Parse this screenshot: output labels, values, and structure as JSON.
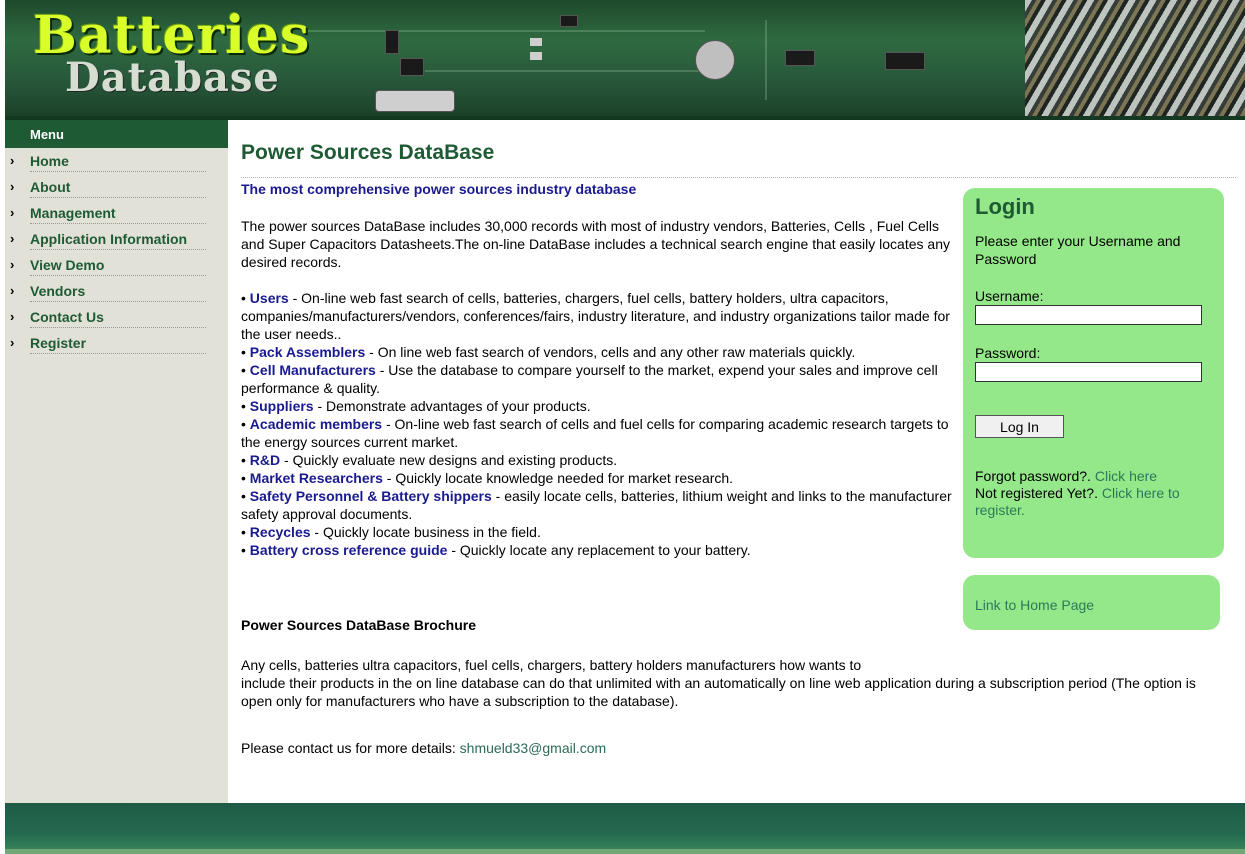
{
  "header": {
    "logo_title": "Batteries",
    "logo_subtitle": "Database"
  },
  "sidebar": {
    "title": "Menu",
    "items": [
      {
        "label": "Home"
      },
      {
        "label": "About"
      },
      {
        "label": "Management"
      },
      {
        "label": "Application Information"
      },
      {
        "label": "View Demo"
      },
      {
        "label": "Vendors"
      },
      {
        "label": "Contact Us"
      },
      {
        "label": "Register"
      }
    ]
  },
  "main": {
    "title": "Power Sources DataBase",
    "tagline": "The most comprehensive power sources industry database",
    "intro": "The  power sources DataBase includes 30,000 records with most of  industry vendors, Batteries, Cells , Fuel Cells and Super Capacitors Datasheets.The on-line DataBase includes a technical search engine that easily locates any desired records.",
    "bullets": [
      {
        "term": "Users",
        "text": " - On-line web fast search of cells, batteries, chargers, fuel cells, battery holders, ultra capacitors, companies/manufacturers/vendors, conferences/fairs, industry literature, and industry organizations tailor made for the user needs.."
      },
      {
        "term": "Pack Assemblers",
        "text": " - On line web fast search of vendors, cells and any other raw materials quickly."
      },
      {
        "term": "Cell Manufacturers",
        "text": " - Use the database to compare yourself to the market, expend your sales and improve cell performance & quality."
      },
      {
        "term": "Suppliers",
        "text": " - Demonstrate advantages of your products."
      },
      {
        "term": "Academic members",
        "text": " - On-line web fast search of cells and fuel cells for comparing academic research targets to the energy sources current market."
      },
      {
        "term": "R&D",
        "text": " - Quickly evaluate new designs and existing products."
      },
      {
        "term": "Market Researchers",
        "text": " - Quickly locate knowledge needed for market research."
      },
      {
        "term": "Safety Personnel & Battery shippers",
        "text": " - easily locate cells, batteries, lithium weight and links to the manufacturer safety approval documents."
      },
      {
        "term": "Recycles",
        "text": " - Quickly locate business in the field."
      },
      {
        "term": "Battery cross reference guide",
        "text": " - Quickly locate any replacement to your battery."
      }
    ],
    "brochure_label": "Power Sources DataBase Brochure",
    "closing_line1": "Any cells, batteries ultra capacitors, fuel cells, chargers, battery holders manufacturers how wants to",
    "closing_line2": "include their products in the on line database can do that unlimited with an automatically on line web application during a subscription period (The option is open only for manufacturers who have a subscription to the database).",
    "contact_prefix": "Please contact us for more details: ",
    "contact_email": "shmueld33@gmail.com"
  },
  "login": {
    "title": "Login",
    "instructions": "Please enter your Username and Password",
    "username_label": "Username:",
    "password_label": "Password:",
    "button_label": "Log In",
    "forgot_text": "Forgot password?. ",
    "forgot_link": "Click here",
    "register_text": "Not registered Yet?. ",
    "register_link": "Click here to register."
  },
  "home_box": {
    "link": "Link to Home Page"
  },
  "colors": {
    "brand_green": "#1e5b34",
    "panel_green": "#95e889",
    "link_blue": "#1a1a8f",
    "sidebar_bg": "#e1e1d8"
  }
}
